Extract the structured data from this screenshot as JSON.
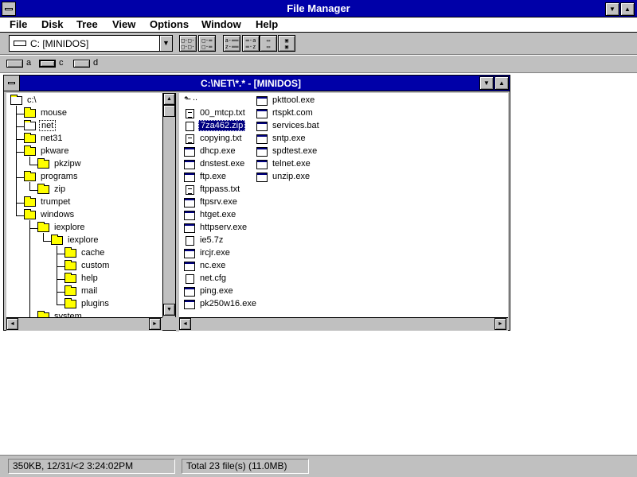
{
  "app": {
    "title": "File Manager"
  },
  "menu": [
    "File",
    "Disk",
    "Tree",
    "View",
    "Options",
    "Window",
    "Help"
  ],
  "toolbar": {
    "drive_value": "C: [MINIDOS]",
    "buttons": [
      "a:b:\n-:-:",
      "a:-\n-:-",
      "a:--\nz:--",
      "-:a\n-:z",
      "",
      ""
    ]
  },
  "drives": [
    {
      "letter": "a",
      "type": "floppy"
    },
    {
      "letter": "c",
      "type": "hard-disk",
      "selected": true
    },
    {
      "letter": "d",
      "type": "network"
    }
  ],
  "window": {
    "title": "C:\\NET\\*.* - [MINIDOS]"
  },
  "tree": [
    {
      "label": "c:\\",
      "depth": 0,
      "open": true
    },
    {
      "label": "mouse",
      "depth": 1
    },
    {
      "label": "net",
      "depth": 1,
      "open": true,
      "focused": true
    },
    {
      "label": "net31",
      "depth": 1
    },
    {
      "label": "pkware",
      "depth": 1
    },
    {
      "label": "pkzipw",
      "depth": 2
    },
    {
      "label": "programs",
      "depth": 1
    },
    {
      "label": "zip",
      "depth": 2
    },
    {
      "label": "trumpet",
      "depth": 1
    },
    {
      "label": "windows",
      "depth": 1
    },
    {
      "label": "iexplore",
      "depth": 2
    },
    {
      "label": "iexplore",
      "depth": 3
    },
    {
      "label": "cache",
      "depth": 4
    },
    {
      "label": "custom",
      "depth": 4
    },
    {
      "label": "help",
      "depth": 4
    },
    {
      "label": "mail",
      "depth": 4
    },
    {
      "label": "plugins",
      "depth": 4
    },
    {
      "label": "system",
      "depth": 2
    }
  ],
  "files": {
    "column1": [
      {
        "name": "..",
        "kind": "up"
      },
      {
        "name": "00_mtcp.txt",
        "kind": "doc"
      },
      {
        "name": "7za462.zip",
        "kind": "file",
        "selected": true
      },
      {
        "name": "copying.txt",
        "kind": "doc"
      },
      {
        "name": "dhcp.exe",
        "kind": "exe"
      },
      {
        "name": "dnstest.exe",
        "kind": "exe"
      },
      {
        "name": "ftp.exe",
        "kind": "exe"
      },
      {
        "name": "ftppass.txt",
        "kind": "doc"
      },
      {
        "name": "ftpsrv.exe",
        "kind": "exe"
      },
      {
        "name": "htget.exe",
        "kind": "exe"
      },
      {
        "name": "httpserv.exe",
        "kind": "exe"
      },
      {
        "name": "ie5.7z",
        "kind": "file"
      },
      {
        "name": "ircjr.exe",
        "kind": "exe"
      },
      {
        "name": "nc.exe",
        "kind": "exe"
      },
      {
        "name": "net.cfg",
        "kind": "file"
      },
      {
        "name": "ping.exe",
        "kind": "exe"
      },
      {
        "name": "pk250w16.exe",
        "kind": "exe"
      }
    ],
    "column2": [
      {
        "name": "pkttool.exe",
        "kind": "exe"
      },
      {
        "name": "rtspkt.com",
        "kind": "exe"
      },
      {
        "name": "services.bat",
        "kind": "exe"
      },
      {
        "name": "sntp.exe",
        "kind": "exe"
      },
      {
        "name": "spdtest.exe",
        "kind": "exe"
      },
      {
        "name": "telnet.exe",
        "kind": "exe"
      },
      {
        "name": "unzip.exe",
        "kind": "exe"
      }
    ]
  },
  "status": {
    "left": "350KB, 12/31/<2 3:24:02PM",
    "right": "Total 23 file(s) (11.0MB)"
  },
  "icons": {
    "minimize": "triangle-down",
    "maximize": "triangle-up",
    "dropdown": "arrow-down"
  }
}
